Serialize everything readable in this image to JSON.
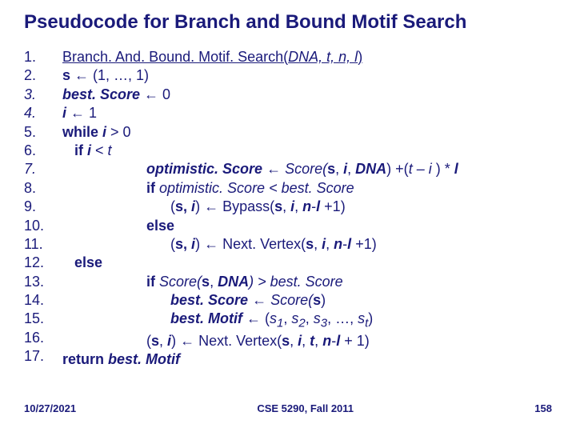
{
  "title": "Pseudocode for Branch and Bound Motif Search",
  "nums": {
    "n1": "1.",
    "n2": "2.",
    "n3": "3.",
    "n4": "4.",
    "n5": "5.",
    "n6": "6.",
    "n7": "7.",
    "n8": "8.",
    "n9": "9.",
    "n10": "10.",
    "n11": "11.",
    "n12": "12.",
    "n13": "13.",
    "n14": "14.",
    "n15": "15.",
    "n16": "16.",
    "n17": "17."
  },
  "line1": {
    "t": "Branch. And. Bound. Motif. Search(",
    "args": "DNA, t, n, l",
    "close": ")"
  },
  "line2": {
    "pre": "s ",
    "arrow": "←",
    "post": " (1, …, 1)"
  },
  "line3": {
    "pre": "best. Score ",
    "arrow": "←",
    "post": " 0"
  },
  "line4": {
    "pre": "i ",
    "arrow": "←",
    "post": " 1"
  },
  "line5": {
    "while": "while ",
    "var": "i",
    "rest": " > 0"
  },
  "line6": {
    "indent": "   ",
    "iff": "if ",
    "v1": "i",
    "mid": " < ",
    "v2": "t"
  },
  "line7": {
    "indent": "                     ",
    "a": "optimistic. Score ",
    "arrow": "←",
    "b": " Score(",
    "c": "s",
    "d": ", ",
    "e": "i",
    "f": ", ",
    "g": "DNA",
    "h": ") +(",
    "ii": "t – i ",
    "j": ") * ",
    "k": "l"
  },
  "line8": {
    "indent": "                     ",
    "iff": "if ",
    "a": "optimistic. Score < best. Score"
  },
  "line9": {
    "indent": "                           (",
    "a": "s, ",
    "b": "i",
    "c": ") ",
    "arrow": "←",
    "d": " Bypass(",
    "e": "s",
    "f": ", ",
    "g": "i",
    "h": ", ",
    "ii": "n",
    "j": "-",
    "k": "l ",
    "l": "+1)"
  },
  "line10": {
    "indent": "                     ",
    "elsew": "else"
  },
  "line11": {
    "indent": "                           (",
    "a": "s, ",
    "b": "i",
    "c": ") ",
    "arrow": "←",
    "d": " Next. Vertex(",
    "e": "s",
    "f": ", ",
    "g": "i",
    "h": ", ",
    "ii": "n",
    "j": "-",
    "k": "l ",
    "l": "+1)"
  },
  "line12": {
    "indent": "   ",
    "elsew": "else"
  },
  "line13": {
    "indent": "                     ",
    "iff": "if ",
    "a": "Score(",
    "b": "s",
    "c": ", ",
    "d": "DNA",
    "e": ") > best. Score"
  },
  "line14": {
    "indent": "                           ",
    "a": "best. Score ",
    "arrow": "←",
    "b": " Score(",
    "c": "s",
    "d": ")"
  },
  "line15": {
    "indent": "                           ",
    "a": "best. Motif ",
    "arrow": "←",
    "b": " (",
    "c": "s",
    "d1": "1",
    "e": ", ",
    "f": "s",
    "d2": "2",
    "g": ", ",
    "h": "s",
    "d3": "3",
    "ii": ", …, ",
    "j": "s",
    "dt": "t",
    "k": ")"
  },
  "line16": {
    "indent": "                     (",
    "a": "s",
    "b": ", ",
    "c": "i",
    "d": ") ",
    "arrow": "←",
    "e": " Next. Vertex(",
    "f": "s",
    "g": ", ",
    "h": "i",
    "gg": ", ",
    "hh": "t",
    "ii": ", ",
    "j": "n",
    "k": "-",
    "l": "l ",
    "m": "+ 1)"
  },
  "line17": {
    "ret": "return ",
    "a": "best. Motif"
  },
  "footer": {
    "left": "10/27/2021",
    "center": "CSE 5290, Fall 2011",
    "right": "158"
  }
}
